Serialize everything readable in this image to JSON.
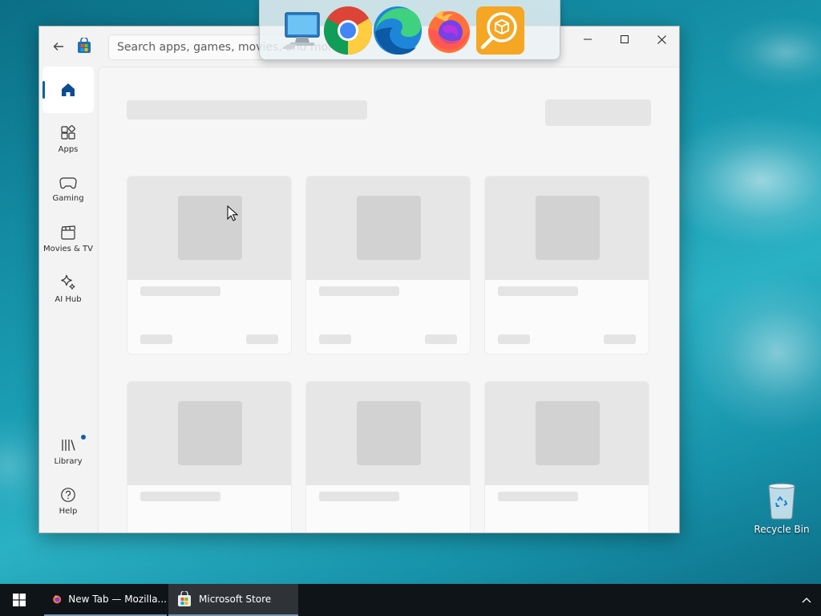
{
  "window": {
    "search_placeholder": "Search apps, games, movies, and more"
  },
  "nav": {
    "items": [
      {
        "label": "Home",
        "icon": "home-icon"
      },
      {
        "label": "Apps",
        "icon": "apps-icon"
      },
      {
        "label": "Gaming",
        "icon": "gamepad-icon"
      },
      {
        "label": "Movies & TV",
        "icon": "clapperboard-icon"
      },
      {
        "label": "AI Hub",
        "icon": "sparkle-icon"
      },
      {
        "label": "Library",
        "icon": "library-icon"
      },
      {
        "label": "Help",
        "icon": "help-icon"
      }
    ]
  },
  "dock": {
    "apps": [
      "computer-icon",
      "chrome-icon",
      "edge-icon",
      "firefox-icon",
      "package-search-icon"
    ]
  },
  "desktop": {
    "recycle_bin_label": "Recycle Bin"
  },
  "taskbar": {
    "items": [
      {
        "label": "New Tab — Mozilla...",
        "icon": "firefox-icon"
      },
      {
        "label": "Microsoft Store",
        "icon": "store-icon"
      }
    ]
  },
  "colors": {
    "accent": "#0f5fb0",
    "taskbar": "#0f1419",
    "skeleton": "#e5e5e5"
  }
}
